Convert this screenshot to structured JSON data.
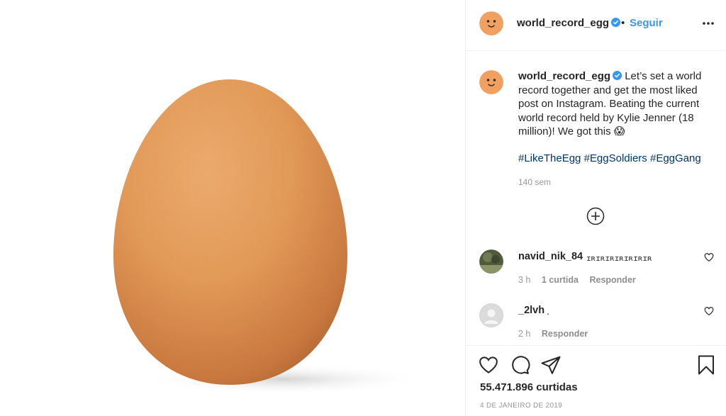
{
  "post": {
    "username": "world_record_egg",
    "follow_label": "Seguir",
    "separator": "•",
    "caption": "Let’s set a world record together and get the most liked post on Instagram. Beating the current world record held by Kylie Jenner (18 million)! We got this",
    "caption_emoji": "😱",
    "hashtags": [
      "#LikeTheEgg",
      "#EggSoldiers",
      "#EggGang"
    ],
    "caption_time": "140 sem",
    "likes": "55.471.896 curtidas",
    "date": "4 DE JANEIRO DE 2019"
  },
  "comments": [
    {
      "username": "navid_nik_84",
      "text": "ɪʀɪʀɪʀɪʀɪʀɪʀɪʀ",
      "time": "3 h",
      "likes": "1 curtida",
      "reply": "Responder"
    },
    {
      "username": "_2lvh",
      "text": ".",
      "time": "2 h",
      "reply": "Responder"
    }
  ],
  "colors": {
    "link": "#3897f0",
    "hashtag": "#003569",
    "verified": "#3897f0",
    "egg": "#e39352"
  }
}
